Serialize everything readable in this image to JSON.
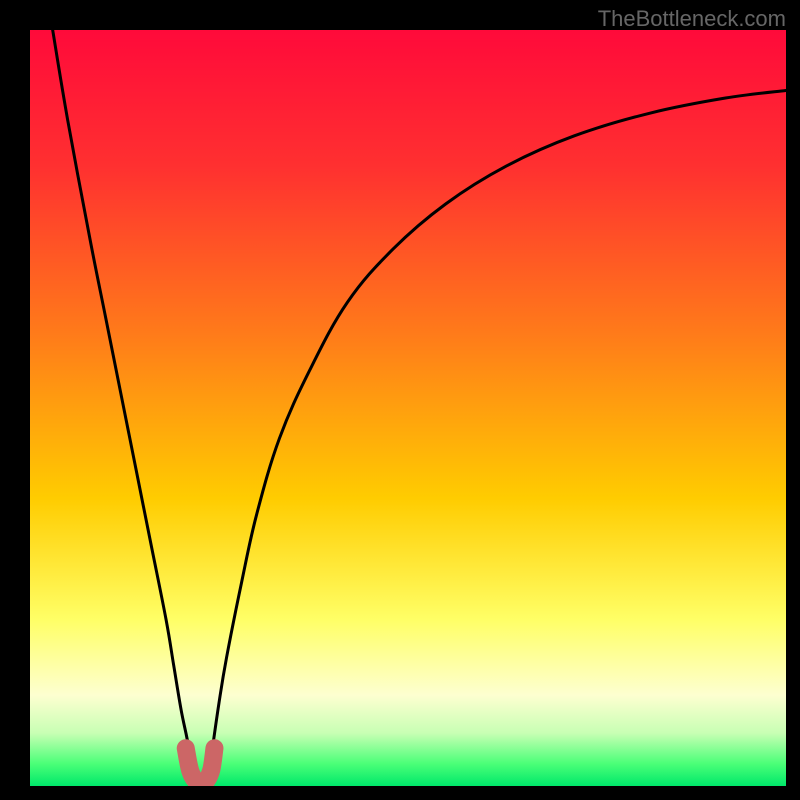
{
  "watermark": "TheBottleneck.com",
  "chart_data": {
    "type": "line",
    "title": "",
    "xlabel": "",
    "ylabel": "",
    "xlim": [
      0,
      100
    ],
    "ylim": [
      0,
      100
    ],
    "grid": false,
    "legend": false,
    "annotations": [],
    "series": [
      {
        "name": "curve-left",
        "x": [
          3,
          5,
          8,
          10,
          12,
          14,
          16,
          18,
          19,
          20,
          21,
          21.5
        ],
        "values": [
          100,
          88,
          72,
          62,
          52,
          42,
          32,
          22,
          16,
          10,
          5,
          0
        ]
      },
      {
        "name": "curve-right",
        "x": [
          23.5,
          24,
          25,
          26,
          28,
          30,
          33,
          37,
          42,
          48,
          55,
          63,
          72,
          82,
          92,
          100
        ],
        "values": [
          0,
          4,
          11,
          17,
          27,
          36,
          46,
          55,
          64,
          71,
          77,
          82,
          86,
          89,
          91,
          92
        ]
      },
      {
        "name": "dip-marker",
        "x": [
          20.6,
          21.2,
          22.0,
          22.8,
          23.4,
          24.0,
          24.4
        ],
        "values": [
          5.0,
          2.0,
          0.6,
          0.4,
          0.8,
          2.2,
          5.0
        ]
      }
    ],
    "colors": {
      "curve": "#000000",
      "marker_stroke": "#cc6666",
      "marker_fill": "#cc6666",
      "gradient_stops": [
        {
          "offset": 0,
          "color": "#ff0a3a"
        },
        {
          "offset": 18,
          "color": "#ff3030"
        },
        {
          "offset": 40,
          "color": "#ff7a1a"
        },
        {
          "offset": 62,
          "color": "#ffcc00"
        },
        {
          "offset": 78,
          "color": "#ffff66"
        },
        {
          "offset": 88,
          "color": "#fdffd0"
        },
        {
          "offset": 93,
          "color": "#c8ffb4"
        },
        {
          "offset": 97,
          "color": "#4cff78"
        },
        {
          "offset": 100,
          "color": "#00e86a"
        }
      ]
    }
  }
}
